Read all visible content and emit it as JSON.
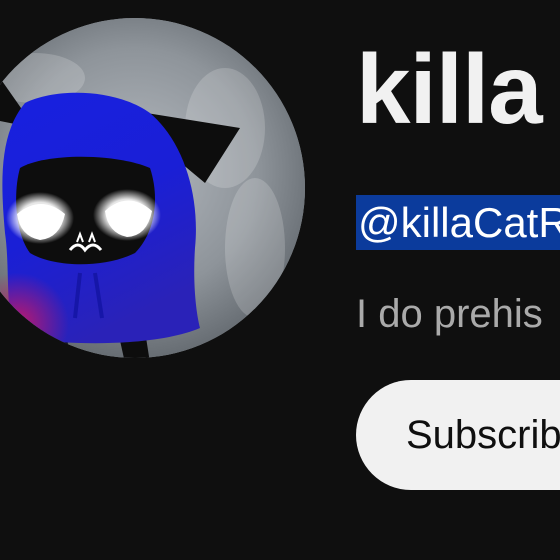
{
  "channel": {
    "name": "killa",
    "handle": "@killaCatR",
    "description": "I do prehis",
    "subscribe_label": "Subscrib"
  },
  "avatar": {
    "icon": "avatar-image",
    "alt": "",
    "colors": {
      "background": "#8e949a",
      "hoodie": "#1a1fd6",
      "gradient": "#b0156a",
      "ears_legs": "#0d0d0d",
      "eyes": "#ffffff"
    }
  },
  "colors": {
    "page_background": "#0f0f0f",
    "text_primary": "#f1f1f1",
    "text_secondary": "#aaaaaa",
    "selection_highlight": "#0b3b9c",
    "button_background": "#f1f1f1",
    "button_text": "#0f0f0f"
  }
}
